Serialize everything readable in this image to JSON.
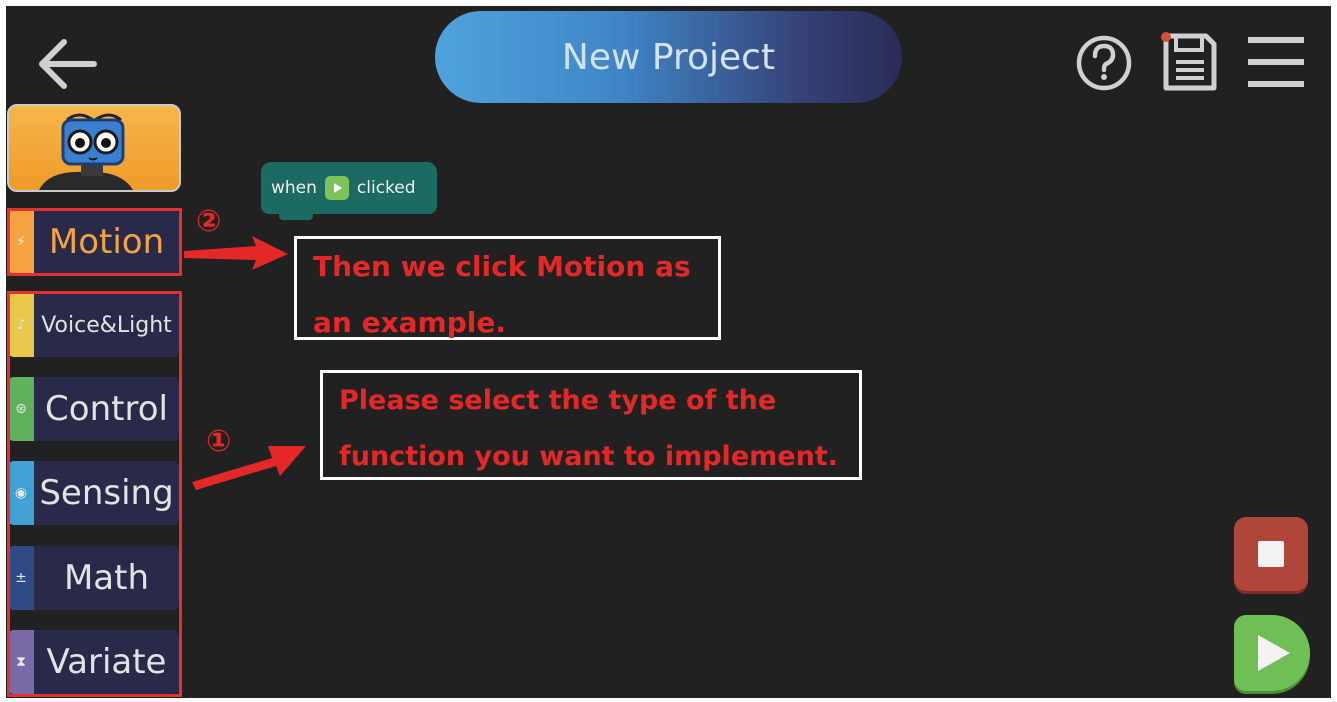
{
  "header": {
    "title": "New Project",
    "back_icon": "arrow-left-icon",
    "help_icon": "question-circle-icon",
    "save_icon": "save-disk-icon",
    "menu_icon": "hamburger-menu-icon"
  },
  "categories": [
    {
      "label": "Motion",
      "icon": "motion-icon",
      "color": "#f4a340"
    },
    {
      "label": "Voice&Light",
      "icon": "music-note-icon",
      "color": "#e8c84a"
    },
    {
      "label": "Control",
      "icon": "steering-wheel-icon",
      "color": "#5fb15e"
    },
    {
      "label": "Sensing",
      "icon": "signal-icon",
      "color": "#3fa1d4"
    },
    {
      "label": "Math",
      "icon": "math-icon",
      "color": "#2f4b85"
    },
    {
      "label": "Variate",
      "icon": "flask-icon",
      "color": "#7a6aa8"
    }
  ],
  "block": {
    "text_before": "when",
    "text_after": "clicked",
    "color": "#1b6b63"
  },
  "annotations": {
    "marker_1": "①",
    "marker_2": "②",
    "note_motion_line1": "Then we click Motion as",
    "note_motion_line2": "an example.",
    "note_type_line1": "Please select the type of the",
    "note_type_line2": "function you want to implement."
  },
  "controls": {
    "stop_icon": "stop-icon",
    "play_icon": "play-icon"
  },
  "colors": {
    "background": "#212121",
    "annotation_red": "#e42727",
    "stop": "#b0463a",
    "play": "#6fbf56"
  }
}
